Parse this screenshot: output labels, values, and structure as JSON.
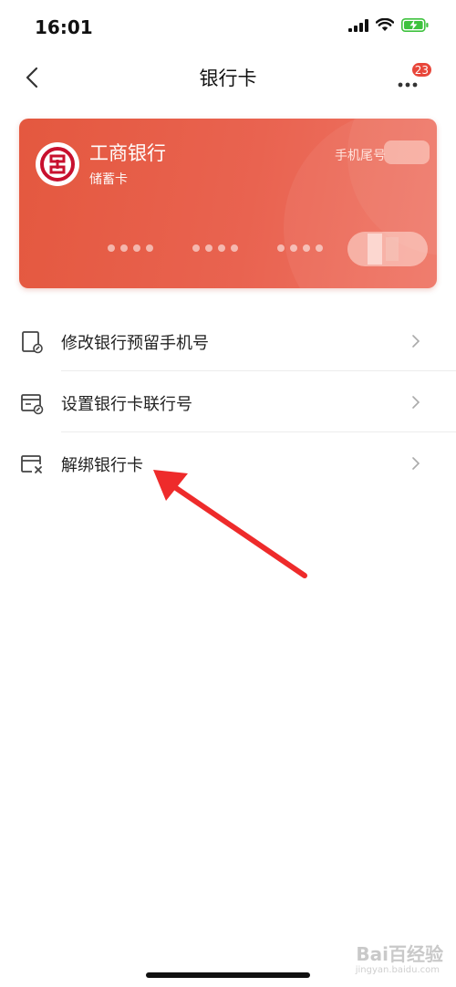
{
  "status_bar": {
    "time": "16:01"
  },
  "nav": {
    "title": "银行卡",
    "badge_count": "23"
  },
  "card": {
    "bank_name": "工商银行",
    "card_type": "储蓄卡",
    "phone_tail_label": "手机尾号",
    "accent_color": "#e4583f"
  },
  "menu": {
    "items": [
      {
        "label": "修改银行预留手机号",
        "icon": "phone-edit-icon"
      },
      {
        "label": "设置银行卡联行号",
        "icon": "card-settings-icon"
      },
      {
        "label": "解绑银行卡",
        "icon": "card-unbind-icon"
      }
    ]
  },
  "watermark": {
    "text": "Bai百经验",
    "sub": "jingyan.baidu.com"
  },
  "colors": {
    "annotation_arrow": "#ee2b2b",
    "badge": "#e8463a"
  }
}
